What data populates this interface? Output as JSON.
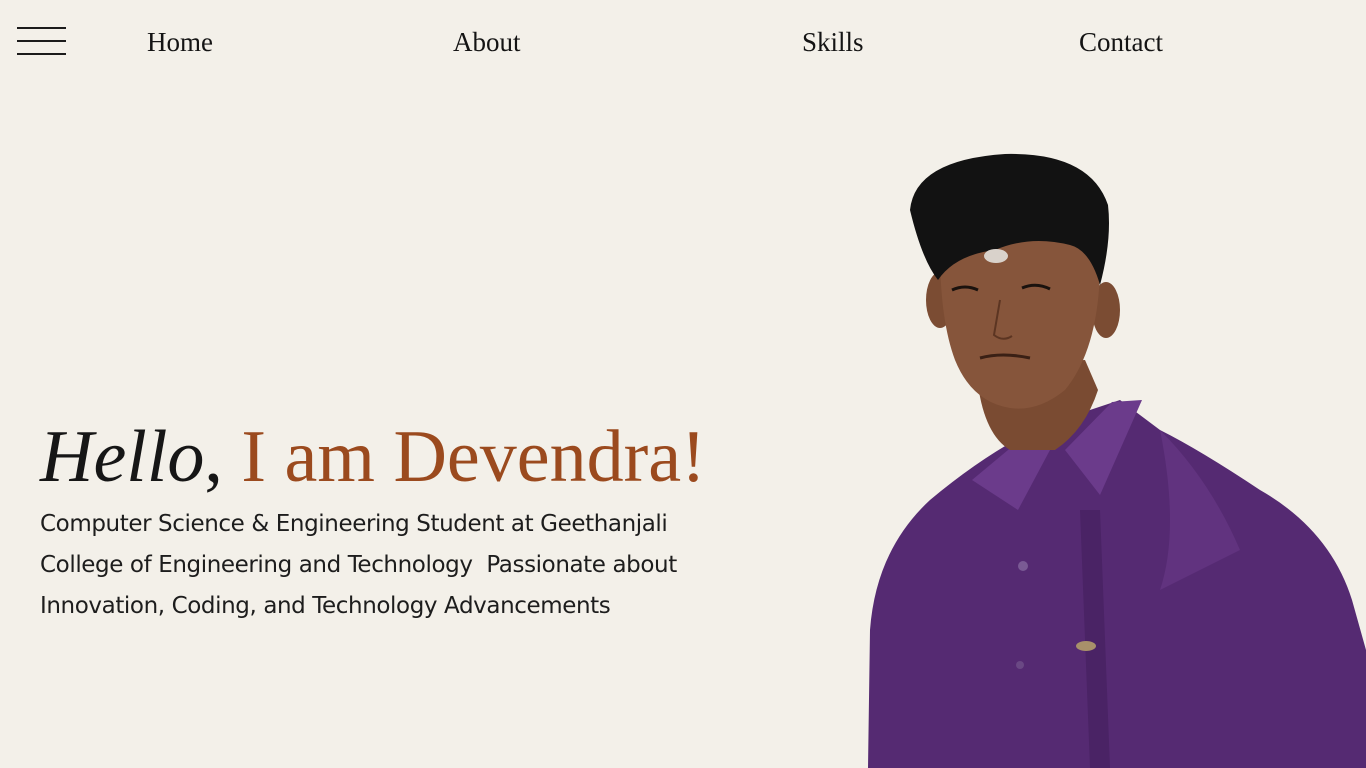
{
  "nav": {
    "menu_icon": "hamburger-menu-icon",
    "items": [
      {
        "label": "Home"
      },
      {
        "label": "About"
      },
      {
        "label": "Skills"
      },
      {
        "label": "Contact"
      }
    ]
  },
  "hero": {
    "greeting_italic": "Hello",
    "greeting_comma": ", ",
    "name_text": "I am Devendra!",
    "intro_lines": [
      "Computer Science & Engineering Student at Geethanjali",
      "College of Engineering and Technology  Passionate about",
      "Innovation, Coding, and Technology Advancements"
    ]
  },
  "colors": {
    "background": "#f3f0e9",
    "accent": "#9b4a1e",
    "text": "#1b1b1b",
    "shirt": "#5a2d77"
  }
}
